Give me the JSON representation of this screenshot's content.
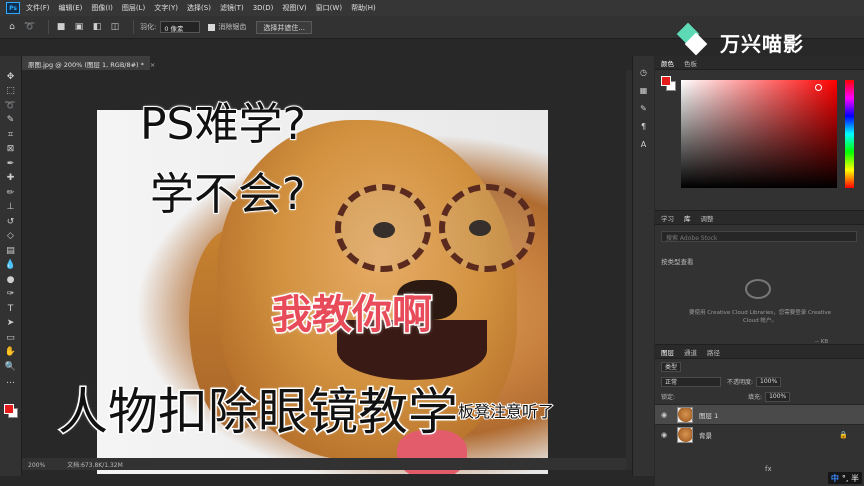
{
  "menubar": {
    "logo": "Ps",
    "items": [
      "文件(F)",
      "编辑(E)",
      "图像(I)",
      "图层(L)",
      "文字(Y)",
      "选择(S)",
      "滤镜(T)",
      "3D(D)",
      "视图(V)",
      "窗口(W)",
      "帮助(H)"
    ]
  },
  "options": {
    "feather_label": "羽化:",
    "feather_value": "0 像素",
    "antialias_label": "消除锯齿",
    "select_mask_button": "选择并遮住..."
  },
  "brand": {
    "text": "万兴喵影"
  },
  "document": {
    "tab_title": "原图.jpg @ 200% (图层 1, RGB/8#) *",
    "zoom": "200%",
    "doc_info": "文档:673.8K/1.32M"
  },
  "captions": {
    "line1": "PS难学?",
    "line2": "学不会?",
    "line3": "我教你啊",
    "title": "人物扣除眼镜教学",
    "subtitle": "板凳注意听了"
  },
  "color_panel": {
    "tabs": [
      "颜色",
      "色板"
    ],
    "foreground": "#e41c1c",
    "background": "#ffffff"
  },
  "libraries_panel": {
    "tabs": [
      "学习",
      "库",
      "调整"
    ],
    "search_placeholder": "搜索 Adobe Stock",
    "view_label": "按类型查看",
    "message": "要使用 Creative Cloud Libraries，您需要登录 Creative Cloud 帐户。",
    "size": "-- KB"
  },
  "layers_panel": {
    "tabs": [
      "图层",
      "通道",
      "路径"
    ],
    "kind_label": "类型",
    "blend_mode": "正常",
    "opacity_label": "不透明度:",
    "opacity_value": "100%",
    "lock_label": "锁定:",
    "fill_label": "填充:",
    "fill_value": "100%",
    "layers": [
      {
        "name": "图层 1",
        "selected": true
      },
      {
        "name": "背景",
        "selected": false
      }
    ]
  },
  "ime": {
    "lang": "中",
    "mode": "°, 半"
  }
}
